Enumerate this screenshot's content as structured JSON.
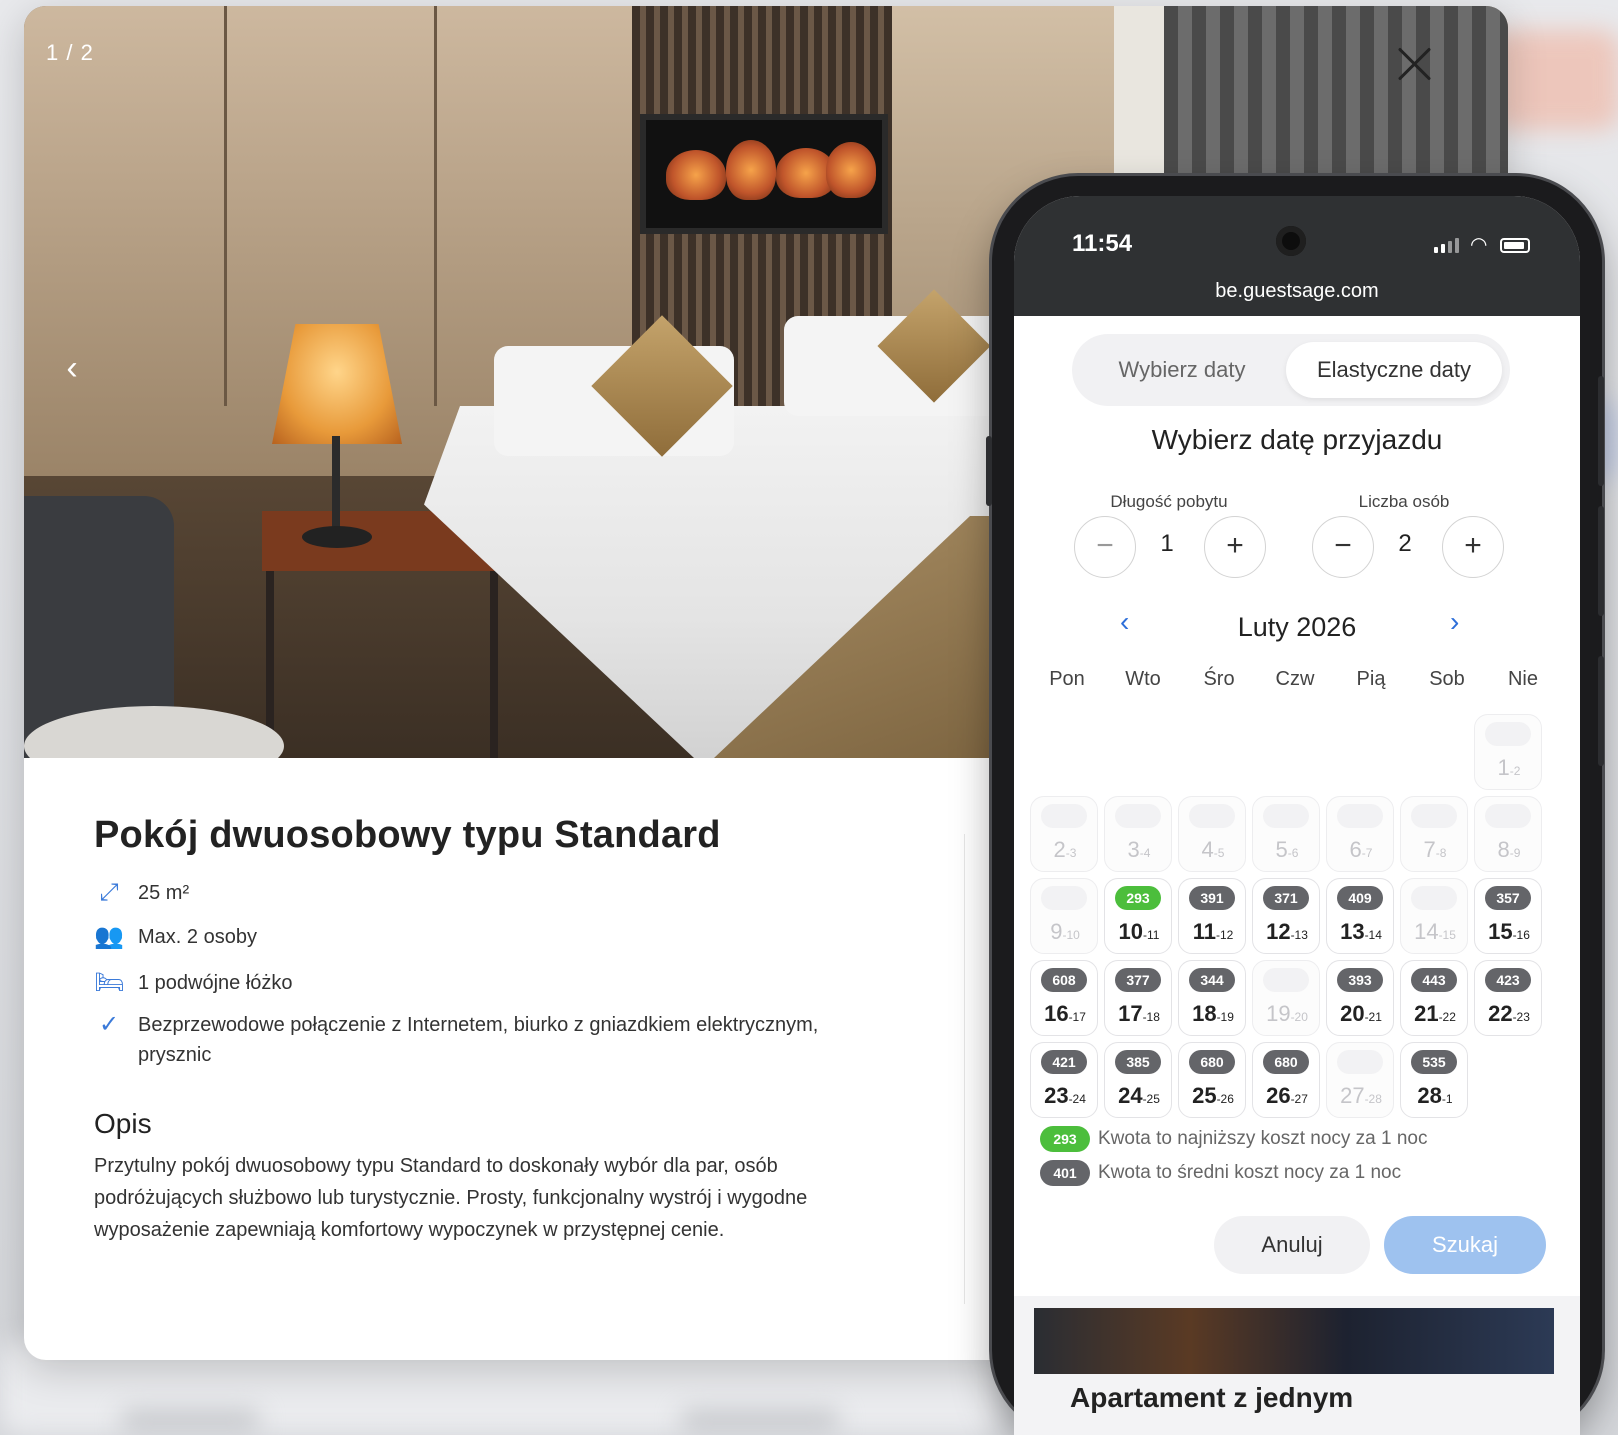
{
  "modal": {
    "counter": "1 / 2",
    "prev_icon": "‹",
    "room": {
      "title": "Pokój dwuosobowy typu Standard",
      "features": [
        {
          "icon": "expand-arrows-icon",
          "glyph": "⤢",
          "text": "25 m²"
        },
        {
          "icon": "people-icon",
          "glyph": "👥",
          "text": "Max. 2 osoby"
        },
        {
          "icon": "bed-icon",
          "glyph": "🛏",
          "text": "1 podwójne łóżko"
        },
        {
          "icon": "checkmark-icon",
          "glyph": "✓",
          "text": "Bezprzewodowe połączenie z Internetem, biurko z gniazdkiem elektrycznym, prysznic"
        }
      ],
      "description_title": "Opis",
      "description": "Przytulny pokój dwuosobowy typu Standard to doskonały wybór dla par, osób podróżujących służbowo lub turystycznie. Prosty, funkcjonalny wystrój i wygodne wyposażenie zapewniają komfortowy wypoczynek w przystępnej cenie."
    }
  },
  "phone": {
    "time": "11:54",
    "url": "be.guestsage.com",
    "tabs": [
      "Wybierz daty",
      "Elastyczne daty"
    ],
    "heading": "Wybierz datę przyjazdu",
    "stay_length_label": "Długość pobytu",
    "stay_length": "1",
    "guests_label": "Liczba osób",
    "guests": "2",
    "minus": "−",
    "plus": "+",
    "prev_month": "‹",
    "next_month": "›",
    "month": "Luty 2026",
    "weekdays": [
      "Pon",
      "Wto",
      "Śro",
      "Czw",
      "Pią",
      "Sob",
      "Nie"
    ],
    "days": [
      {
        "d": "1",
        "n": "2",
        "price": "",
        "avail": false
      },
      {
        "d": "2",
        "n": "3",
        "price": "",
        "avail": false
      },
      {
        "d": "3",
        "n": "4",
        "price": "",
        "avail": false
      },
      {
        "d": "4",
        "n": "5",
        "price": "",
        "avail": false
      },
      {
        "d": "5",
        "n": "6",
        "price": "",
        "avail": false
      },
      {
        "d": "6",
        "n": "7",
        "price": "",
        "avail": false
      },
      {
        "d": "7",
        "n": "8",
        "price": "",
        "avail": false
      },
      {
        "d": "8",
        "n": "9",
        "price": "",
        "avail": false
      },
      {
        "d": "9",
        "n": "10",
        "price": "",
        "avail": false
      },
      {
        "d": "10",
        "n": "11",
        "price": "293",
        "avail": true,
        "lowest": true
      },
      {
        "d": "11",
        "n": "12",
        "price": "391",
        "avail": true
      },
      {
        "d": "12",
        "n": "13",
        "price": "371",
        "avail": true
      },
      {
        "d": "13",
        "n": "14",
        "price": "409",
        "avail": true
      },
      {
        "d": "14",
        "n": "15",
        "price": "",
        "avail": false
      },
      {
        "d": "15",
        "n": "16",
        "price": "357",
        "avail": true
      },
      {
        "d": "16",
        "n": "17",
        "price": "608",
        "avail": true
      },
      {
        "d": "17",
        "n": "18",
        "price": "377",
        "avail": true
      },
      {
        "d": "18",
        "n": "19",
        "price": "344",
        "avail": true
      },
      {
        "d": "19",
        "n": "20",
        "price": "",
        "avail": false
      },
      {
        "d": "20",
        "n": "21",
        "price": "393",
        "avail": true
      },
      {
        "d": "21",
        "n": "22",
        "price": "443",
        "avail": true
      },
      {
        "d": "22",
        "n": "23",
        "price": "423",
        "avail": true
      },
      {
        "d": "23",
        "n": "24",
        "price": "421",
        "avail": true
      },
      {
        "d": "24",
        "n": "25",
        "price": "385",
        "avail": true
      },
      {
        "d": "25",
        "n": "26",
        "price": "680",
        "avail": true
      },
      {
        "d": "26",
        "n": "27",
        "price": "680",
        "avail": true
      },
      {
        "d": "27",
        "n": "28",
        "price": "",
        "avail": false
      },
      {
        "d": "28",
        "n": "1",
        "price": "535",
        "avail": true
      }
    ],
    "first_weekday_index": 6,
    "legend": [
      {
        "value": "293",
        "text": "Kwota to najniższy koszt nocy za 1 noc",
        "color": "#4cbe3c"
      },
      {
        "value": "401",
        "text": "Kwota to średni koszt nocy za 1 noc",
        "color": "#646569"
      }
    ],
    "cancel": "Anuluj",
    "search": "Szukaj",
    "next_room_title": "Apartament z jednym"
  },
  "colors": {
    "accent": "#2e6fd9",
    "lowest_price": "#4cbe3c",
    "avg_price": "#646569",
    "search_button": "#9ec2ef"
  }
}
